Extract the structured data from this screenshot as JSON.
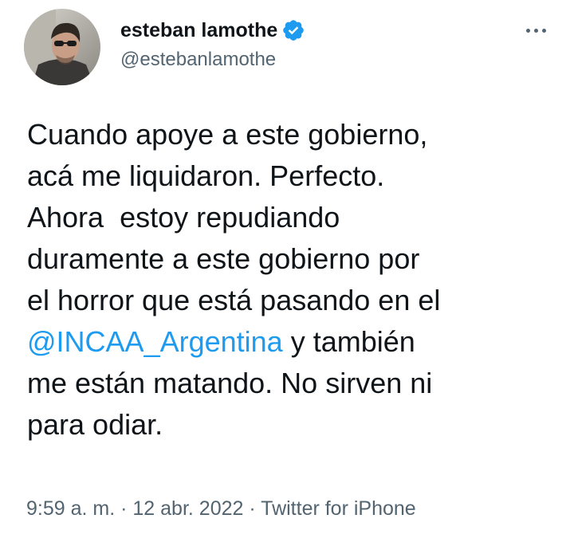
{
  "author": {
    "display_name": "esteban lamothe",
    "handle": "@estebanlamothe",
    "verified": true,
    "avatar_icon": "profile-photo"
  },
  "more_icon": "more-horizontal-icon",
  "tweet": {
    "lines": [
      "Cuando apoye a este gobierno,",
      "acá me liquidaron. Perfecto.",
      "Ahora  estoy repudiando",
      "duramente a este gobierno por",
      "el horror que está pasando en el"
    ],
    "mention": "@INCAA_Argentina",
    "after_mention": " y también",
    "lines_end": [
      "me están matando. No sirven ni",
      "para odiar."
    ]
  },
  "meta": {
    "time": "9:59 a. m.",
    "separator": " · ",
    "date": "12 abr. 2022",
    "source": "Twitter for iPhone"
  },
  "colors": {
    "text": "#0f1419",
    "secondary": "#536471",
    "link": "#1d9bf0"
  }
}
